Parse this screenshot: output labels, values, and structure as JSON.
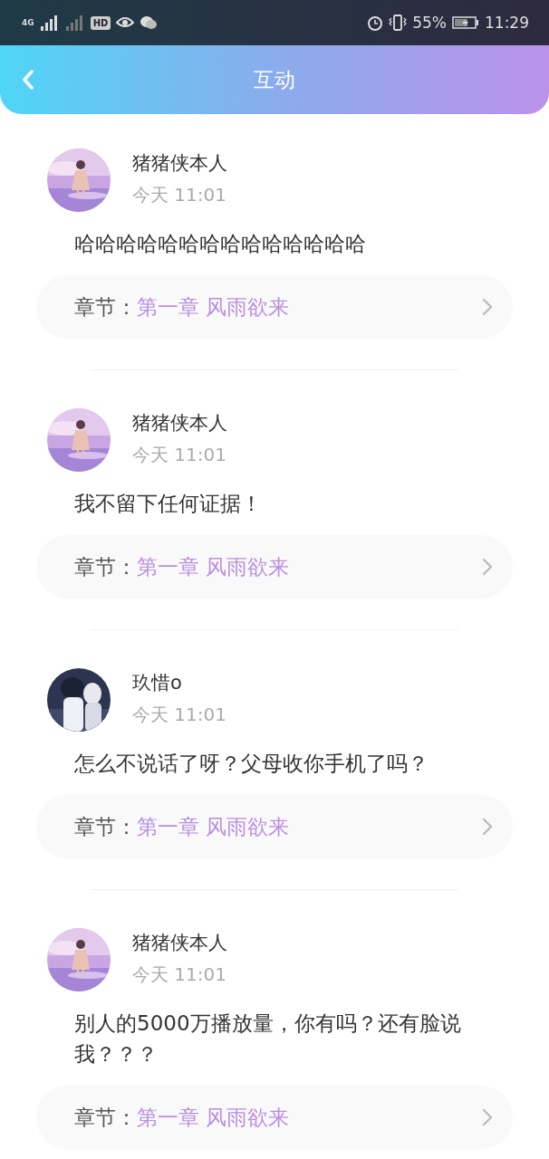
{
  "status_bar": {
    "network": "4G",
    "hd": "HD",
    "battery": "55%",
    "time": "11:29"
  },
  "header": {
    "title": "互动"
  },
  "comments": [
    {
      "name": "猪猪侠本人",
      "time": "今天 11:01",
      "text": "哈哈哈哈哈哈哈哈哈哈哈哈哈哈",
      "chapter_label": "章节：",
      "chapter_title": "第一章 风雨欲来"
    },
    {
      "name": "猪猪侠本人",
      "time": "今天 11:01",
      "text": "我不留下任何证据！",
      "chapter_label": "章节：",
      "chapter_title": "第一章 风雨欲来"
    },
    {
      "name": "玖惜o",
      "time": "今天 11:01",
      "text": "怎么不说话了呀？父母收你手机了吗？",
      "chapter_label": "章节：",
      "chapter_title": "第一章 风雨欲来"
    },
    {
      "name": "猪猪侠本人",
      "time": "今天 11:01",
      "text": "别人的5000万播放量，你有吗？还有脸说我？？？",
      "chapter_label": "章节：",
      "chapter_title": "第一章 风雨欲来"
    }
  ]
}
